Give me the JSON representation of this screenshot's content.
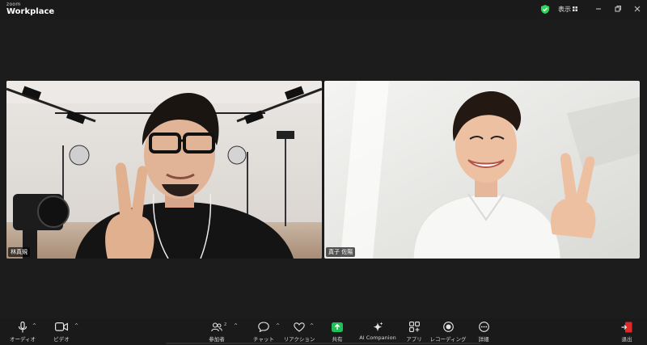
{
  "app": {
    "brand_small": "zoom",
    "brand_large": "Workplace"
  },
  "titlebar": {
    "view_label": "表示"
  },
  "participants": [
    {
      "name": "林真規"
    },
    {
      "name": "真子 佐陽"
    }
  ],
  "toolbar": {
    "audio": "オーディオ",
    "video": "ビデオ",
    "participants": "参加者",
    "participants_count": "2",
    "chat": "チャット",
    "reactions": "リアクション",
    "share": "共有",
    "ai_companion": "AI Companion",
    "apps": "アプリ",
    "record": "レコーディング",
    "more": "詳細",
    "leave": "退出"
  },
  "colors": {
    "share_green": "#1fbf5a",
    "leave_red": "#e02828",
    "secure_green": "#2fd45a"
  }
}
